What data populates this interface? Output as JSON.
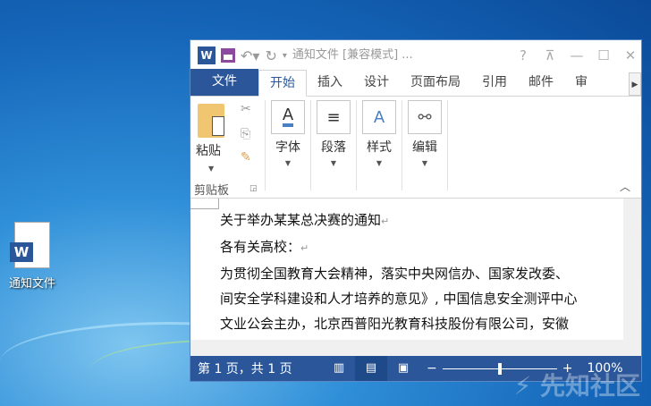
{
  "desktop": {
    "icon_label": "通知文件",
    "watermark": "先知社区"
  },
  "window": {
    "title": "通知文件 [兼容模式] ...",
    "help": "?",
    "logo": "W"
  },
  "tabs": [
    "文件",
    "开始",
    "插入",
    "设计",
    "页面布局",
    "引用",
    "邮件",
    "审"
  ],
  "ribbon": {
    "paste": "粘贴",
    "clipboard_group": "剪贴板",
    "font": "字体",
    "paragraph": "段落",
    "styles": "样式",
    "editing": "编辑"
  },
  "document": {
    "lines": [
      "关于举办某某总决赛的通知",
      "各有关高校：",
      "为贯彻全国教育大会精神，落实中央网信办、国家发改委、",
      "间安全学科建设和人才培养的意见》, 中国信息安全测评中心",
      "文业公会主办，北京西普阳光教育科技股份有限公司，安徽"
    ]
  },
  "status": {
    "page_info": "第 1 页，共 1 页",
    "zoom": "100%",
    "zoom_level": 100
  },
  "colors": {
    "accent": "#2b579a"
  }
}
